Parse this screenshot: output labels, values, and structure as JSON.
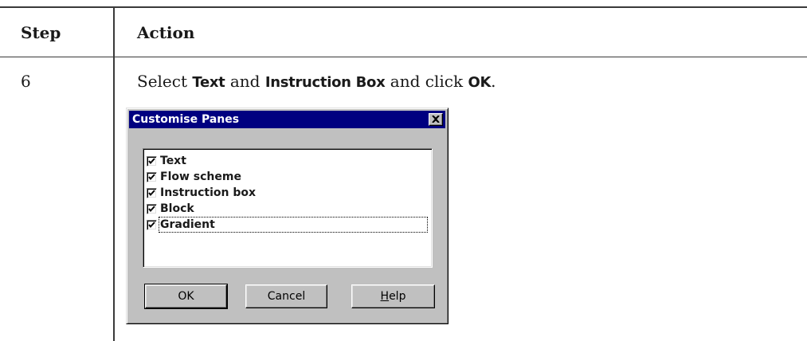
{
  "table": {
    "header": {
      "step": "Step",
      "action": "Action"
    },
    "row": {
      "step": "6",
      "instruction_prefix": "Select ",
      "keyword1": "Text",
      "instruction_mid": " and ",
      "keyword2": "Instruction Box",
      "instruction_mid2": " and click ",
      "keyword3": "OK",
      "instruction_suffix": "."
    }
  },
  "dialog": {
    "title": "Customise Panes",
    "close_icon": "close-icon",
    "items": [
      {
        "label": "Text",
        "checked": true
      },
      {
        "label": "Flow scheme",
        "checked": true
      },
      {
        "label": "Instruction box",
        "checked": true
      },
      {
        "label": "Block",
        "checked": true
      },
      {
        "label": "Gradient",
        "checked": true,
        "focused": true
      }
    ],
    "buttons": {
      "ok": "OK",
      "cancel": "Cancel",
      "help_accel": "H",
      "help_rest": "elp"
    }
  },
  "colors": {
    "titlebar": "#000080",
    "dialog_face": "#c0c0c0",
    "rules": "#3a3a3a"
  }
}
